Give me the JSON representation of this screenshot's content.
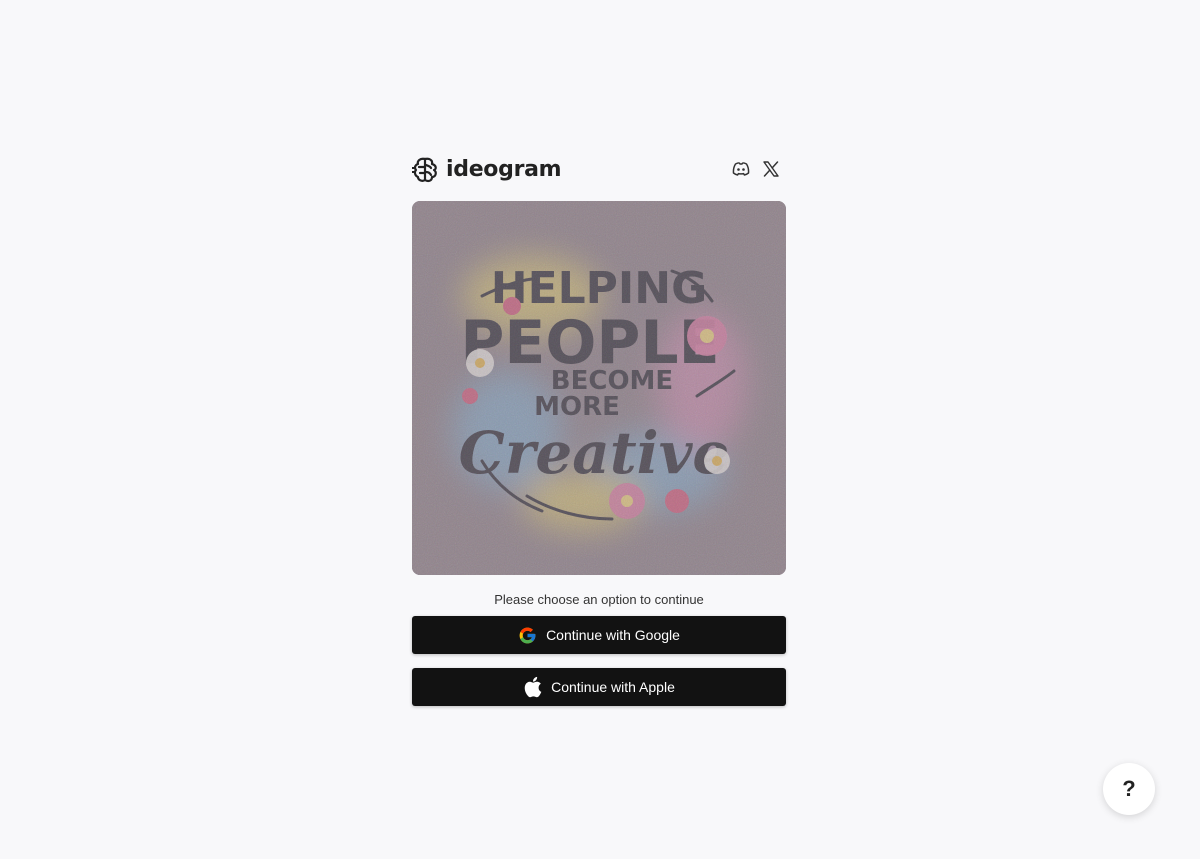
{
  "brand": {
    "name": "ideogram",
    "logo_icon": "brain-logo-icon"
  },
  "socials": [
    {
      "icon": "discord-icon"
    },
    {
      "icon": "x-twitter-icon"
    }
  ],
  "hero": {
    "lines": [
      "HELPING",
      "PEOPLE",
      "BECOME",
      "MORE",
      "Creative"
    ],
    "colors": {
      "background": "#8e8288",
      "ink": "#2a2a32",
      "splash_yellow": "#e8d56a",
      "splash_blue": "#7fb4d6",
      "splash_pink": "#d98fb5",
      "flower_pink": "#e07aa3"
    }
  },
  "auth": {
    "prompt": "Please choose an option to continue",
    "google_label": "Continue with Google",
    "apple_label": "Continue with Apple"
  },
  "help": {
    "label": "?"
  },
  "colors": {
    "page_bg": "#f8f8fa",
    "button_bg": "#121212",
    "button_text": "#ffffff"
  }
}
